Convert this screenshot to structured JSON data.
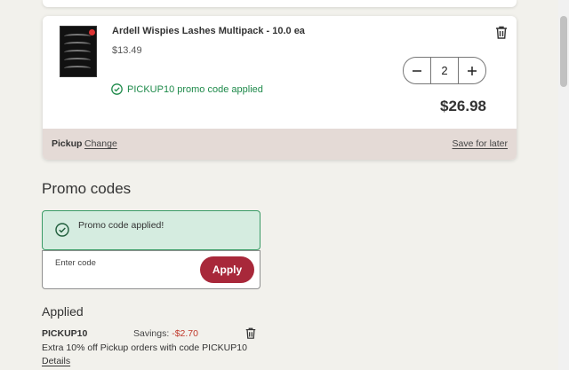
{
  "cart_item": {
    "title": "Ardell Wispies Lashes Multipack - 10.0 ea",
    "unit_price": "$13.49",
    "quantity": "2",
    "promo_applied_text": "PICKUP10 promo code applied",
    "line_total": "$26.98",
    "fulfillment_label": "Pickup",
    "change_label": "Change",
    "save_for_later_label": "Save for later"
  },
  "promo": {
    "section_title": "Promo codes",
    "success_message": "Promo code applied!",
    "input_label": "Enter code",
    "apply_label": "Apply"
  },
  "applied": {
    "heading": "Applied",
    "code": "PICKUP10",
    "savings_label": "Savings:",
    "savings_amount": "-$2.70",
    "description": "Extra 10% off Pickup orders with code PICKUP10",
    "details_label": "Details"
  },
  "colors": {
    "brand_red": "#a8283a",
    "success_green": "#1e8a4a",
    "savings_red": "#c0392b",
    "footer_bg": "#e4dad6",
    "banner_bg": "#d5ece0"
  },
  "icons": {
    "remove_item": "trash-icon",
    "decrease": "minus-icon",
    "increase": "plus-icon",
    "success": "check-circle-icon"
  }
}
